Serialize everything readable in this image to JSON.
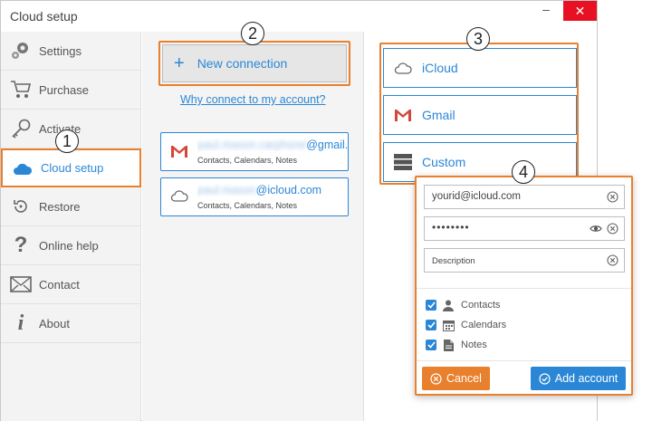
{
  "window": {
    "title": "Cloud setup"
  },
  "sidebar": {
    "items": [
      {
        "label": "Settings",
        "icon": "settings-icon"
      },
      {
        "label": "Purchase",
        "icon": "cart-icon"
      },
      {
        "label": "Activate",
        "icon": "key-icon"
      },
      {
        "label": "Cloud setup",
        "icon": "cloud-icon",
        "active": true
      },
      {
        "label": "Restore",
        "icon": "restore-icon"
      },
      {
        "label": "Online help",
        "icon": "question-icon"
      },
      {
        "label": "Contact",
        "icon": "envelope-icon"
      },
      {
        "label": "About",
        "icon": "info-icon"
      }
    ]
  },
  "middle": {
    "new_connection_label": "New connection",
    "why_link": "Why connect to my account?",
    "accounts": [
      {
        "email_suffix": "@gmail.com",
        "services": "Contacts, Calendars, Notes",
        "icon": "gmail-icon"
      },
      {
        "email_suffix": "@icloud.com",
        "services": "Contacts, Calendars, Notes",
        "icon": "cloud-icon"
      }
    ]
  },
  "right": {
    "services": [
      {
        "label": "iCloud",
        "icon": "cloud-outline-icon"
      },
      {
        "label": "Gmail",
        "icon": "gmail-icon"
      },
      {
        "label": "Custom",
        "icon": "server-icon"
      }
    ]
  },
  "popup": {
    "email_value": "yourid@icloud.com",
    "password_value": "••••••••",
    "description_value": "Description",
    "checkboxes": [
      {
        "label": "Contacts",
        "checked": true
      },
      {
        "label": "Calendars",
        "checked": true
      },
      {
        "label": "Notes",
        "checked": true
      }
    ],
    "cancel_label": "Cancel",
    "add_label": "Add account"
  },
  "callouts": [
    "1",
    "2",
    "3",
    "4"
  ],
  "colors": {
    "accent": "#2b87d6",
    "highlight": "#e8802d",
    "close": "#e81123"
  }
}
